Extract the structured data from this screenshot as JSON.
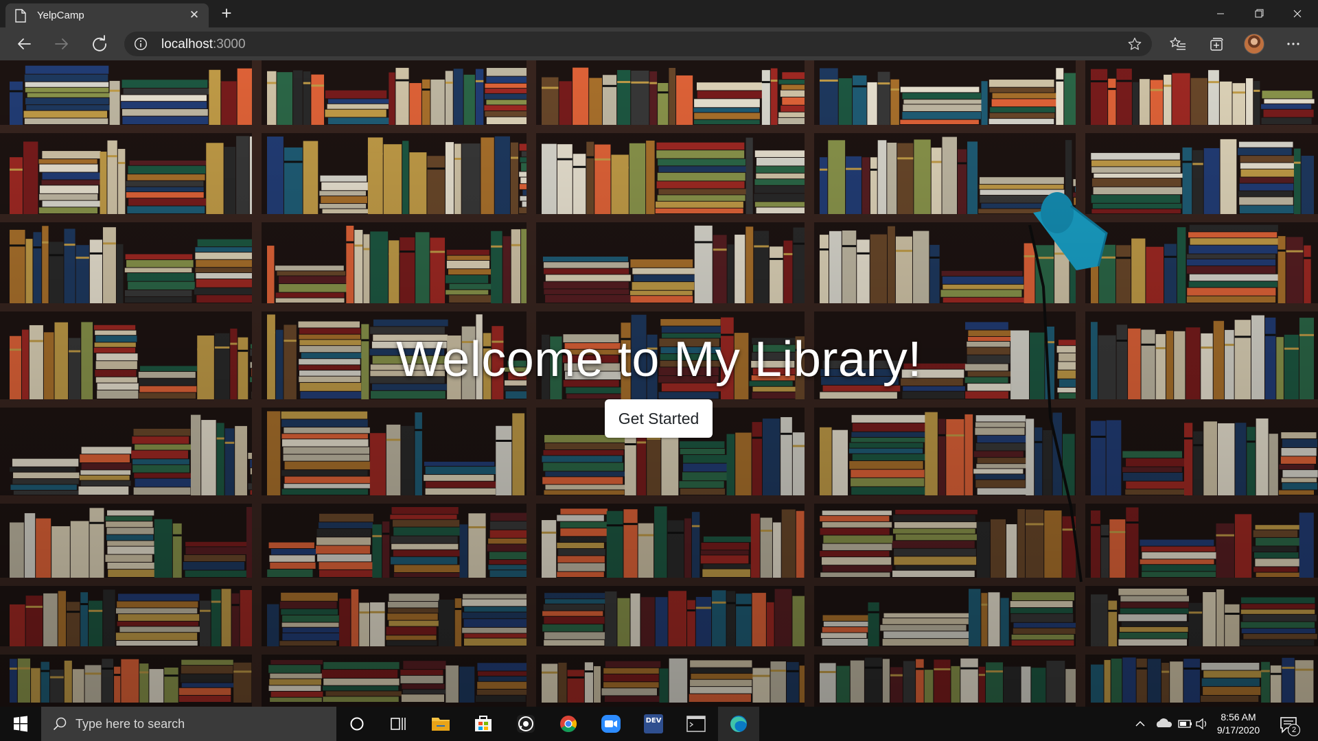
{
  "browser": {
    "tab": {
      "title": "YelpCamp",
      "close_icon": "close-icon",
      "page_icon": "page-icon"
    },
    "new_tab_icon": "plus-icon",
    "window_controls": [
      "minimize-icon",
      "restore-icon",
      "close-icon"
    ],
    "nav": {
      "back_icon": "back-arrow-icon",
      "forward_icon": "forward-arrow-icon",
      "reload_icon": "reload-icon"
    },
    "address": {
      "host": "localhost",
      "port": ":3000",
      "info_icon": "info-icon",
      "favorite_icon": "star-icon"
    },
    "toolbar_icons": [
      "favorites-icon",
      "collections-icon",
      "profile-avatar",
      "more-icon"
    ]
  },
  "hero": {
    "title": "Welcome to My Library!",
    "button_label": "Get Started",
    "background": "bookshelf photo",
    "shelf_color": "#3a2620",
    "lamp_color": "#1aa7cf"
  },
  "taskbar": {
    "search_placeholder": "Type here to search",
    "pinned": [
      "cortana-icon",
      "task-view-icon",
      "file-explorer-icon",
      "store-icon",
      "whatsapp-icon",
      "chrome-icon",
      "zoom-icon",
      "dev-icon",
      "terminal-icon",
      "edge-icon"
    ],
    "dev_label": "DEV",
    "active_app": "edge-icon",
    "clock": {
      "time": "8:56 AM",
      "date": "9/17/2020"
    },
    "notification_count": "2",
    "accent": "#0078d7"
  }
}
